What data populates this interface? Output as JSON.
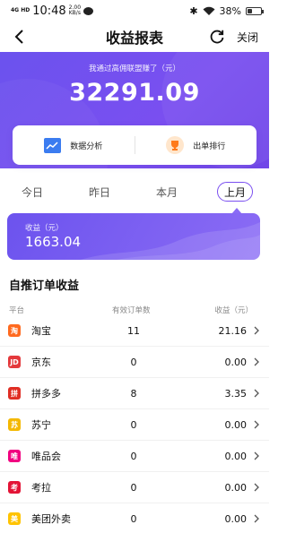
{
  "status": {
    "network": "4G HD",
    "time": "10:48",
    "speed_value": "2.00",
    "speed_unit": "KB/s",
    "battery": "38%",
    "battery_level": 0.38
  },
  "header": {
    "title": "收益报表",
    "close_label": "关闭"
  },
  "banner": {
    "subtitle": "我通过高佣联盟赚了（元）",
    "total": "32291.09"
  },
  "quick": {
    "analysis_label": "数据分析",
    "ranking_label": "出单排行"
  },
  "tabs": [
    {
      "label": "今日",
      "active": false
    },
    {
      "label": "昨日",
      "active": false
    },
    {
      "label": "本月",
      "active": false
    },
    {
      "label": "上月",
      "active": true
    }
  ],
  "summary": {
    "label": "收益（元）",
    "value": "1663.04"
  },
  "section": {
    "title": "自推订单收益",
    "columns": [
      "平台",
      "有效订单数",
      "收益（元）"
    ]
  },
  "rows": [
    {
      "platform": "淘宝",
      "orders": "11",
      "earnings": "21.16",
      "icon": "taobao-icon",
      "color": "#ff6a1f",
      "glyph": "淘"
    },
    {
      "platform": "京东",
      "orders": "0",
      "earnings": "0.00",
      "icon": "jd-icon",
      "color": "#e4393c",
      "glyph": "JD"
    },
    {
      "platform": "拼多多",
      "orders": "8",
      "earnings": "3.35",
      "icon": "pinduoduo-icon",
      "color": "#e02e24",
      "glyph": "拼"
    },
    {
      "platform": "苏宁",
      "orders": "0",
      "earnings": "0.00",
      "icon": "suning-icon",
      "color": "#f4b800",
      "glyph": "苏"
    },
    {
      "platform": "唯品会",
      "orders": "0",
      "earnings": "0.00",
      "icon": "vipshop-icon",
      "color": "#f10180",
      "glyph": "唯"
    },
    {
      "platform": "考拉",
      "orders": "0",
      "earnings": "0.00",
      "icon": "kaola-icon",
      "color": "#e31436",
      "glyph": "考"
    },
    {
      "platform": "美团外卖",
      "orders": "0",
      "earnings": "0.00",
      "icon": "meituan-icon",
      "color": "#ffc300",
      "glyph": "美"
    }
  ],
  "colors": {
    "accent": "#7a4ff0",
    "banner": "#6b52ee"
  }
}
